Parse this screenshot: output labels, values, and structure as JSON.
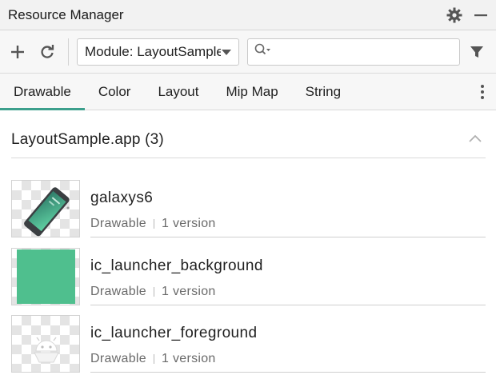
{
  "window": {
    "title": "Resource Manager"
  },
  "toolbar": {
    "module_select_value": "Module: LayoutSample.app",
    "search_placeholder": ""
  },
  "tabs": [
    {
      "label": "Drawable",
      "active": true
    },
    {
      "label": "Color"
    },
    {
      "label": "Layout"
    },
    {
      "label": "Mip Map"
    },
    {
      "label": "String"
    }
  ],
  "section": {
    "title": "LayoutSample.app (3)"
  },
  "resources": [
    {
      "name": "galaxys6",
      "type": "Drawable",
      "versions": "1 version"
    },
    {
      "name": "ic_launcher_background",
      "type": "Drawable",
      "versions": "1 version"
    },
    {
      "name": "ic_launcher_foreground",
      "type": "Drawable",
      "versions": "1 version"
    }
  ],
  "colors": {
    "accent": "#3c9f8c",
    "launcher_green": "#4fbf8e"
  }
}
